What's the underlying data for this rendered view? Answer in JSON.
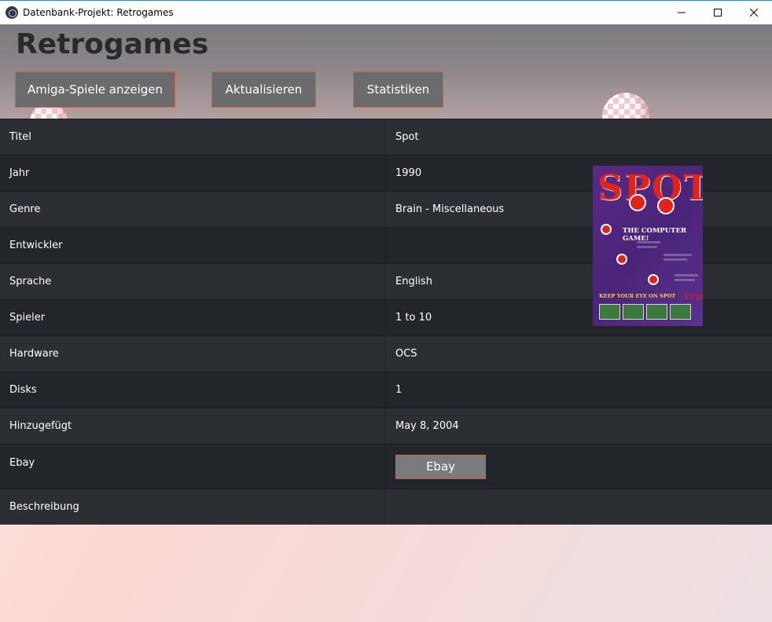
{
  "window": {
    "title": "Datenbank-Projekt: Retrogames"
  },
  "header": {
    "heading": "Retrogames",
    "buttons": [
      {
        "label": "Amiga-Spiele anzeigen"
      },
      {
        "label": "Aktualisieren"
      },
      {
        "label": "Statistiken"
      }
    ]
  },
  "details": {
    "rows": [
      {
        "label": "Titel",
        "value": "Spot"
      },
      {
        "label": "Jahr",
        "value": "1990"
      },
      {
        "label": "Genre",
        "value": "Brain - Miscellaneous"
      },
      {
        "label": "Entwickler",
        "value": ""
      },
      {
        "label": "Sprache",
        "value": "English"
      },
      {
        "label": "Spieler",
        "value": "1 to 10"
      },
      {
        "label": "Hardware",
        "value": "OCS"
      },
      {
        "label": "Disks",
        "value": "1"
      },
      {
        "label": "Hinzugefügt",
        "value": "May 8, 2004"
      },
      {
        "label": "Ebay",
        "button_label": "Ebay"
      },
      {
        "label": "Beschreibung",
        "value": ""
      }
    ]
  },
  "cover": {
    "logo_text": "SPOT",
    "subtitle": "THE COMPUTER GAME!",
    "tagline": "KEEP YOUR EYE ON SPOT",
    "brand": "Virgin"
  },
  "colors": {
    "button_border": "#d6623b",
    "row_dark": "#222529",
    "row_light": "#2b2f34"
  }
}
